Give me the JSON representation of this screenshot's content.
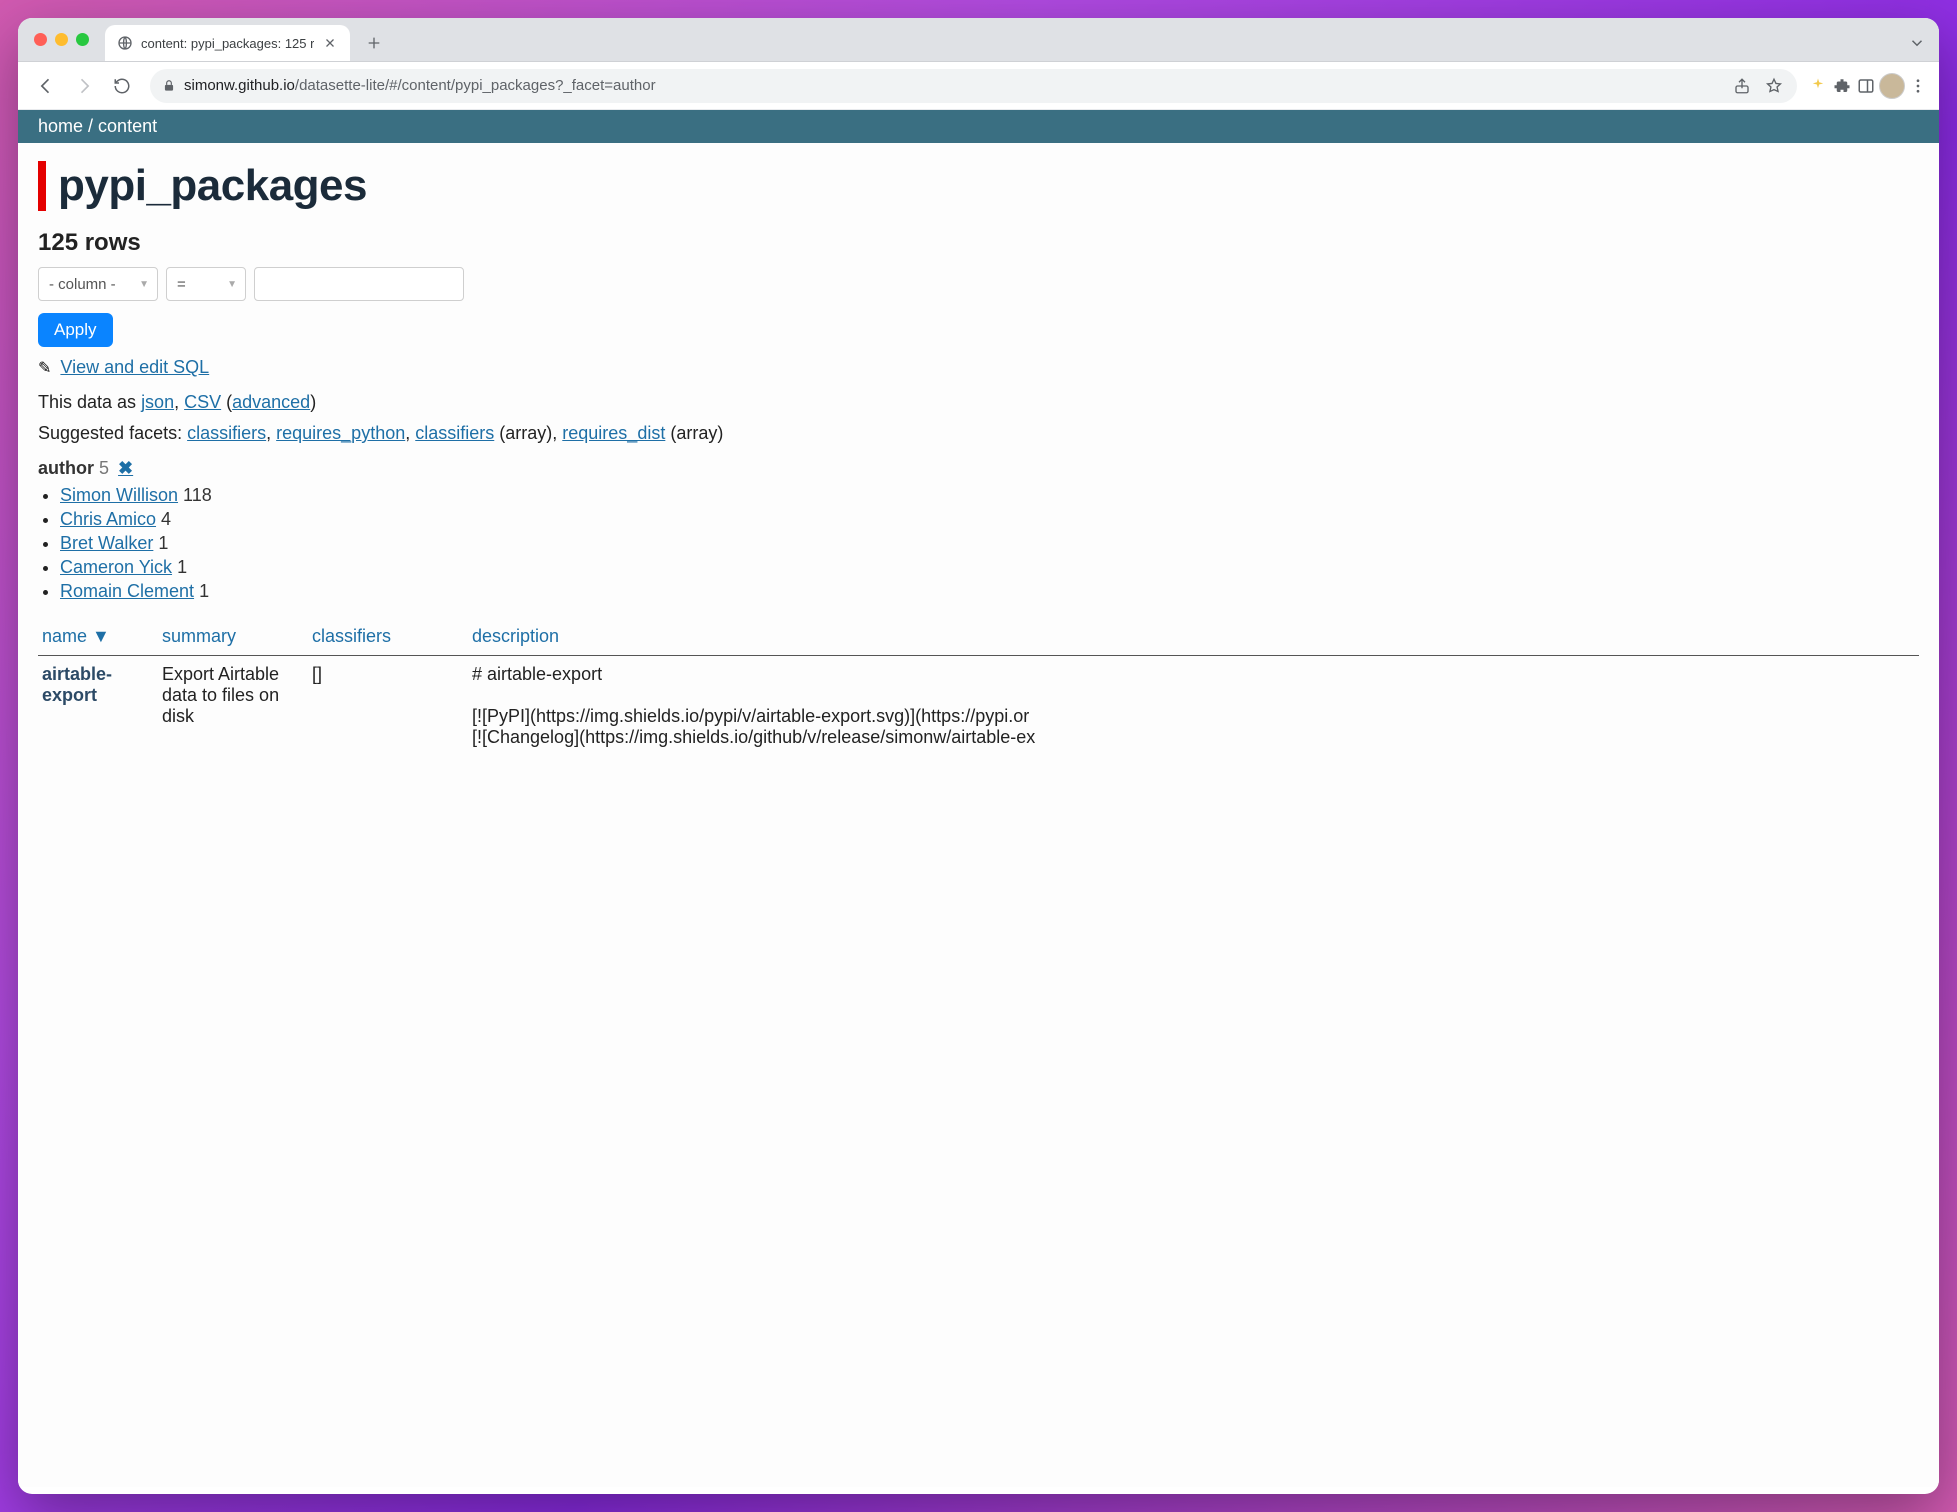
{
  "browser": {
    "tab_title": "content: pypi_packages: 125 r",
    "url_host": "simonw.github.io",
    "url_path": "/datasette-lite/#/content/pypi_packages?_facet=author"
  },
  "breadcrumb": {
    "home": "home",
    "sep": " / ",
    "content": "content"
  },
  "title": "pypi_packages",
  "row_count": "125 rows",
  "filter": {
    "column_placeholder": "- column -",
    "op": "=",
    "value": ""
  },
  "apply_label": "Apply",
  "sql_link": "View and edit SQL",
  "formats": {
    "prefix": "This data as ",
    "json": "json",
    "comma1": ", ",
    "csv": "CSV",
    "space_paren_open": " (",
    "advanced": "advanced",
    "paren_close": ")"
  },
  "facets": {
    "prefix": "Suggested facets: ",
    "items": [
      {
        "label": "classifiers",
        "suffix": ""
      },
      {
        "label": "requires_python",
        "suffix": ""
      },
      {
        "label": "classifiers",
        "suffix": " (array)"
      },
      {
        "label": "requires_dist",
        "suffix": " (array)"
      }
    ]
  },
  "author_facet": {
    "label": "author",
    "count": "5",
    "values": [
      {
        "name": "Simon Willison",
        "n": "118"
      },
      {
        "name": "Chris Amico",
        "n": "4"
      },
      {
        "name": "Bret Walker",
        "n": "1"
      },
      {
        "name": "Cameron Yick",
        "n": "1"
      },
      {
        "name": "Romain Clement",
        "n": "1"
      }
    ]
  },
  "table": {
    "headers": {
      "name": "name",
      "summary": "summary",
      "classifiers": "classifiers",
      "description": "description"
    },
    "row": {
      "name": "airtable-export",
      "summary": "Export Airtable data to files on disk",
      "classifiers": "[]",
      "description_line1": "# airtable-export",
      "description_line2": "[![PyPI](https://img.shields.io/pypi/v/airtable-export.svg)](https://pypi.or",
      "description_line3": "[![Changelog](https://img.shields.io/github/v/release/simonw/airtable-ex"
    }
  }
}
